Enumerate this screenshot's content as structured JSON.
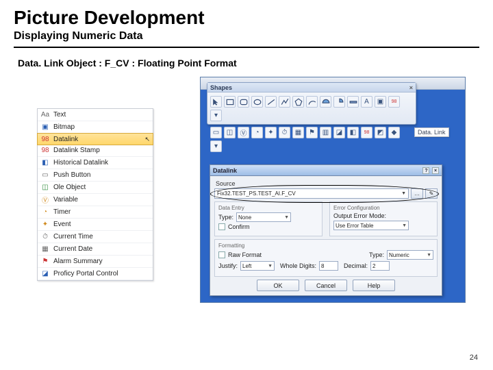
{
  "title": "Picture Development",
  "subtitle": "Displaying Numeric Data",
  "description": "Data. Link Object : F_CV : Floating Point Format",
  "page_number": "24",
  "shapes_toolbar": {
    "title": "Shapes"
  },
  "datalink_hint": "Data. Link",
  "palette": {
    "items": [
      {
        "label": "Text",
        "icon": "Aa",
        "cls": "grey"
      },
      {
        "label": "Bitmap",
        "icon": "▣",
        "cls": "blue"
      },
      {
        "label": "Datalink",
        "icon": "98",
        "cls": "red",
        "selected": true
      },
      {
        "label": "Datalink Stamp",
        "icon": "98",
        "cls": "red"
      },
      {
        "label": "Historical Datalink",
        "icon": "◧",
        "cls": "blue"
      },
      {
        "label": "Push Button",
        "icon": "▭",
        "cls": "grey"
      },
      {
        "label": "Ole Object",
        "icon": "◫",
        "cls": "green"
      },
      {
        "label": "Variable",
        "icon": "Ⓥ",
        "cls": "orange"
      },
      {
        "label": "Timer",
        "icon": "◔",
        "cls": "orange"
      },
      {
        "label": "Event",
        "icon": "✦",
        "cls": "orange"
      },
      {
        "label": "Current Time",
        "icon": "⏱",
        "cls": "grey"
      },
      {
        "label": "Current Date",
        "icon": "▦",
        "cls": "grey"
      },
      {
        "label": "Alarm Summary",
        "icon": "⚑",
        "cls": "red"
      },
      {
        "label": "Proficy Portal Control",
        "icon": "◪",
        "cls": "blue"
      }
    ]
  },
  "dialog": {
    "title": "Datalink",
    "source_label": "Source",
    "source_value": "Fix32.TEST_PS.TEST_AI.F_CV",
    "browse1": "…",
    "browse2": "✎",
    "data_entry": {
      "header": "Data Entry",
      "type_label": "Type:",
      "type_value": "None",
      "confirm_label": "Confirm"
    },
    "error_cfg": {
      "header": "Error Configuration",
      "mode_label": "Output Error Mode:",
      "mode_value": "Use Error Table"
    },
    "formatting": {
      "header": "Formatting",
      "raw_label": "Raw Format",
      "type_label": "Type:",
      "type_value": "Numeric",
      "justify_label": "Justify:",
      "justify_value": "Left",
      "whole_label": "Whole Digits:",
      "whole_value": "8",
      "decimal_label": "Decimal:",
      "decimal_value": "2"
    },
    "buttons": {
      "ok": "OK",
      "cancel": "Cancel",
      "help": "Help"
    }
  }
}
